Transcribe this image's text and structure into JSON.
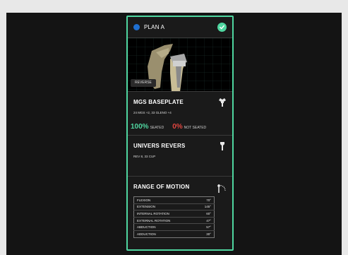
{
  "plan": {
    "title": "PLAN A"
  },
  "image": {
    "tag": "REVERSE"
  },
  "baseplate": {
    "title": "MGS BASEPLATE",
    "subtitle": "24 MGS +2, 33 GLENO +4",
    "seated_pct": "100%",
    "seated_label": "SEATED",
    "not_seated_pct": "0%",
    "not_seated_label": "NOT SEATED"
  },
  "univers": {
    "title": "UNIVERS REVERS",
    "subtitle": "REV 8, 33 CUP"
  },
  "rom": {
    "title": "RANGE OF MOTION",
    "rows": [
      {
        "label": "FLEXION",
        "value": "70°"
      },
      {
        "label": "EXTENSION",
        "value": "145°"
      },
      {
        "label": "INTERNAL ROTATION",
        "value": "60°"
      },
      {
        "label": "EXTERNAL ROTATION",
        "value": "47°"
      },
      {
        "label": "ABDUCTION",
        "value": "57°"
      },
      {
        "label": "ADDUCTION",
        "value": "30°"
      }
    ]
  },
  "colors": {
    "accent": "#4fd6a0",
    "danger": "#e0453f",
    "plan_dot": "#1f6fd0"
  }
}
